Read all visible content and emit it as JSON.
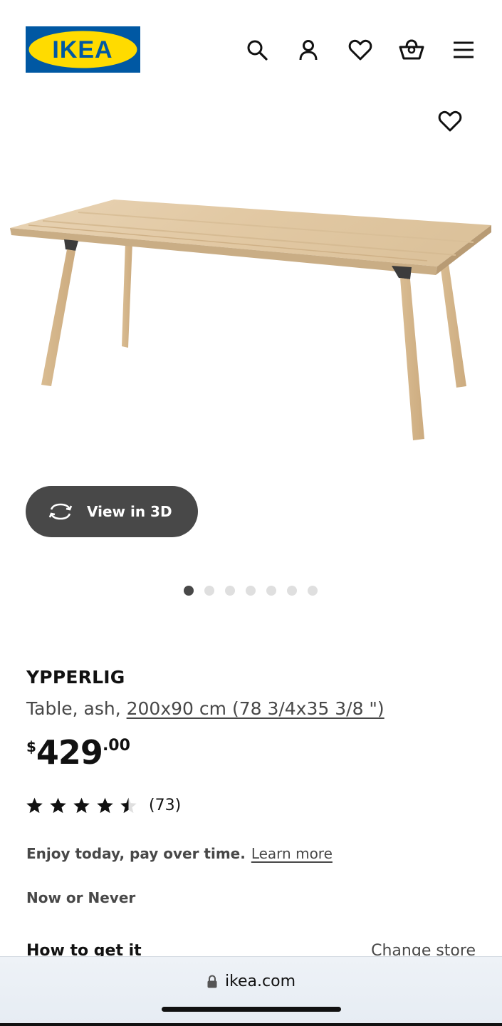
{
  "header": {
    "logo_text": "IKEA",
    "icons": [
      "search-icon",
      "user-icon",
      "heart-icon",
      "basket-icon",
      "menu-icon"
    ]
  },
  "media": {
    "view3d_label": "View in 3D",
    "slide_count": 7,
    "active_slide": 1
  },
  "product": {
    "name": "YPPERLIG",
    "desc_prefix": "Table, ash, ",
    "dimensions": "200x90 cm (78 3/4x35 3/8 \")",
    "price_currency": "$",
    "price_int": "429",
    "price_dec": ".00",
    "rating": 4.5,
    "review_count": "(73)"
  },
  "financing": {
    "text": "Enjoy today, pay over time.",
    "link": "Learn more"
  },
  "tag": "Now or Never",
  "availability": {
    "heading": "How to get it",
    "change_store": "Change store"
  },
  "browser": {
    "url": "ikea.com"
  },
  "colors": {
    "ikea_blue": "#0058a3",
    "ikea_yellow": "#ffdb00",
    "button_dark": "#484848"
  }
}
